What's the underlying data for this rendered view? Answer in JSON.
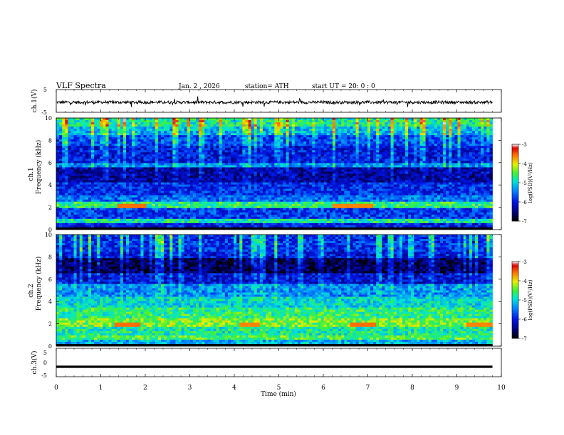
{
  "header": {
    "title": "VLF  Spectra",
    "date": "Jan.  2  , 2026",
    "station": "station= ATH",
    "start_ut": "start  UT  =    20: 0   : 0"
  },
  "chart_data": [
    {
      "type": "line",
      "panel": "ch1-waveform",
      "ylabel": "ch.1(V)",
      "ylim": [
        -5,
        5
      ],
      "yticks": [
        "5",
        "-5"
      ],
      "xlim": [
        0,
        10
      ],
      "x_end": 9.8
    },
    {
      "type": "heatmap",
      "panel": "ch1-spectrogram",
      "ylabel_top": "ch.1",
      "ylabel": "Frequency  (kHz)",
      "ylim": [
        0,
        10
      ],
      "yticks": [
        "0",
        "2",
        "4",
        "6",
        "8",
        "10"
      ],
      "xlim": [
        0,
        10
      ],
      "x_end": 9.8,
      "colorbar": {
        "label": "log(PSD)(V²/Hz)",
        "ticks": [
          "-3",
          "-4",
          "-5",
          "-6",
          "-7"
        ],
        "range": [
          -7,
          -3
        ]
      }
    },
    {
      "type": "heatmap",
      "panel": "ch2-spectrogram",
      "ylabel_top": "ch.2",
      "ylabel": "Frequency  (kHz)",
      "ylim": [
        0,
        10
      ],
      "yticks": [
        "0",
        "2",
        "4",
        "6",
        "8",
        "10"
      ],
      "xlim": [
        0,
        10
      ],
      "x_end": 9.8,
      "colorbar": {
        "label": "log(PSD)(V²/Hz)",
        "ticks": [
          "-3",
          "-4",
          "-5",
          "-6",
          "-7"
        ],
        "range": [
          -7,
          -3
        ]
      }
    },
    {
      "type": "line",
      "panel": "ch3-waveform",
      "ylabel": "ch.3(V)",
      "ylim": [
        -5,
        5
      ],
      "yticks": [
        "5",
        "0",
        "-5"
      ],
      "xlim": [
        0,
        10
      ],
      "x_end": 9.8,
      "level": -1.5
    }
  ],
  "xaxis": {
    "label": "Time  (min)",
    "ticks": [
      "0",
      "1",
      "2",
      "3",
      "4",
      "5",
      "6",
      "7",
      "8",
      "9",
      "10"
    ]
  }
}
